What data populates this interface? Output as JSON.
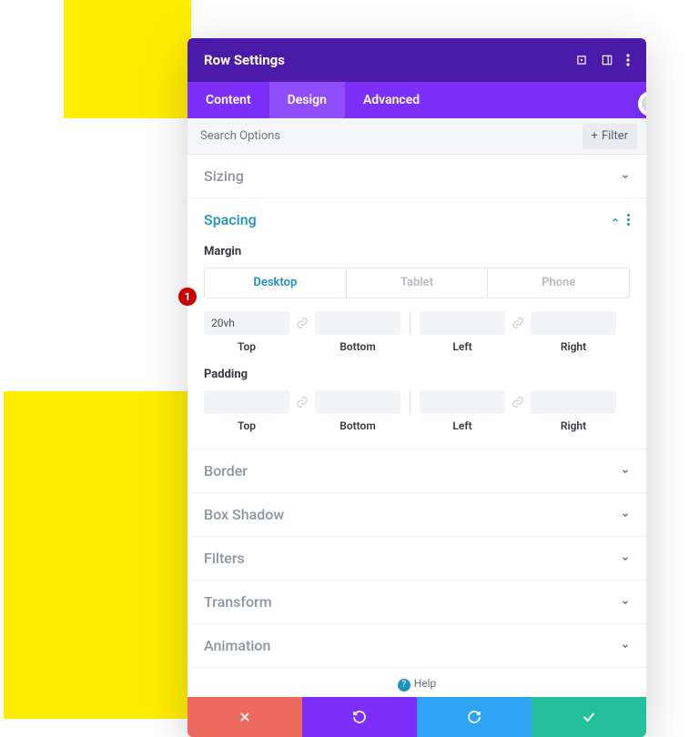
{
  "header": {
    "title": "Row Settings"
  },
  "tabs": [
    {
      "label": "Content",
      "active": false
    },
    {
      "label": "Design",
      "active": true
    },
    {
      "label": "Advanced",
      "active": false
    }
  ],
  "search": {
    "placeholder": "Search Options",
    "filter_label": "Filter"
  },
  "sections": {
    "sizing": {
      "title": "Sizing",
      "open": false
    },
    "spacing": {
      "title": "Spacing",
      "open": true
    },
    "border": {
      "title": "Border",
      "open": false
    },
    "box_shadow": {
      "title": "Box Shadow",
      "open": false
    },
    "filters": {
      "title": "Filters",
      "open": false
    },
    "transform": {
      "title": "Transform",
      "open": false
    },
    "animation": {
      "title": "Animation",
      "open": false
    }
  },
  "spacing": {
    "margin_label": "Margin",
    "padding_label": "Padding",
    "device_tabs": {
      "desktop": "Desktop",
      "tablet": "Tablet",
      "phone": "Phone"
    },
    "sides": {
      "top": "Top",
      "bottom": "Bottom",
      "left": "Left",
      "right": "Right"
    },
    "margin": {
      "top": "20vh",
      "bottom": "",
      "left": "",
      "right": ""
    },
    "padding": {
      "top": "",
      "bottom": "",
      "left": "",
      "right": ""
    }
  },
  "help": {
    "label": "Help"
  },
  "annotation": {
    "badge": "1"
  }
}
